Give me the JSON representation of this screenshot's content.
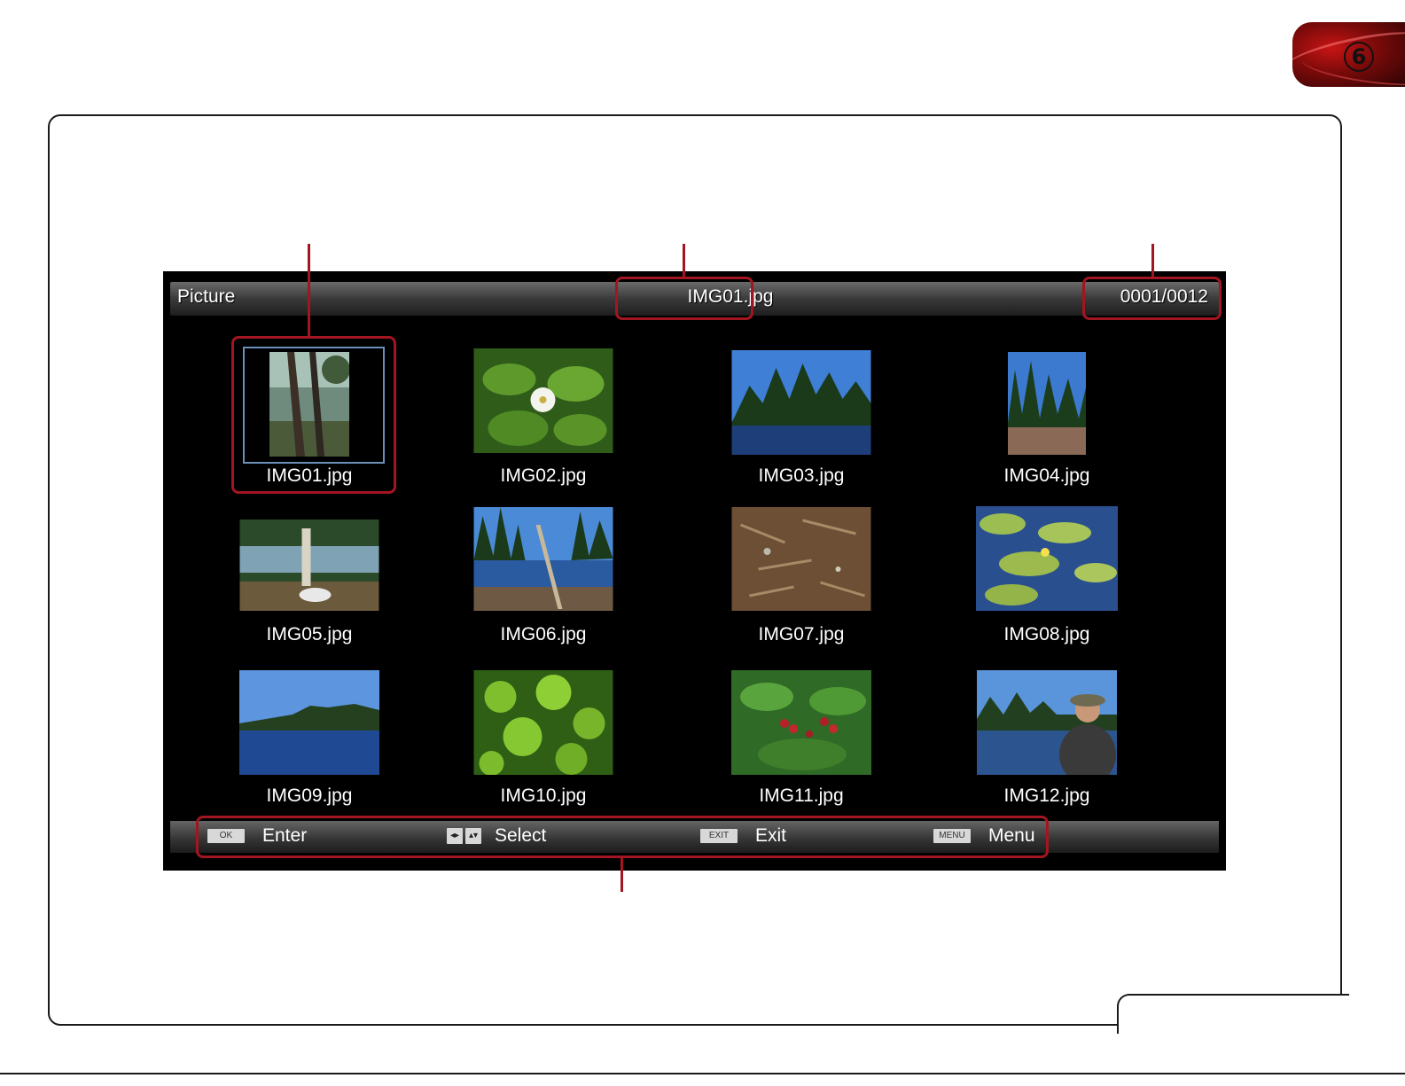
{
  "chapter_tab": {
    "number": "6"
  },
  "screen": {
    "title": "Picture",
    "current_file": "IMG01.jpg",
    "counter": "0001/0012"
  },
  "thumbnails": [
    {
      "label": "IMG01.jpg",
      "selected": true
    },
    {
      "label": "IMG02.jpg",
      "selected": false
    },
    {
      "label": "IMG03.jpg",
      "selected": false
    },
    {
      "label": "IMG04.jpg",
      "selected": false
    },
    {
      "label": "IMG05.jpg",
      "selected": false
    },
    {
      "label": "IMG06.jpg",
      "selected": false
    },
    {
      "label": "IMG07.jpg",
      "selected": false
    },
    {
      "label": "IMG08.jpg",
      "selected": false
    },
    {
      "label": "IMG09.jpg",
      "selected": false
    },
    {
      "label": "IMG10.jpg",
      "selected": false
    },
    {
      "label": "IMG11.jpg",
      "selected": false
    },
    {
      "label": "IMG12.jpg",
      "selected": false
    }
  ],
  "help_bar": {
    "enter": {
      "key": "OK",
      "label": "Enter"
    },
    "select": {
      "label": "Select"
    },
    "exit": {
      "key": "EXIT",
      "label": "Exit"
    },
    "menu": {
      "key": "MENU",
      "label": "Menu"
    }
  },
  "colors": {
    "callout": "#a11620",
    "selection": "#6b8fb8",
    "screen_bg": "#000000"
  }
}
